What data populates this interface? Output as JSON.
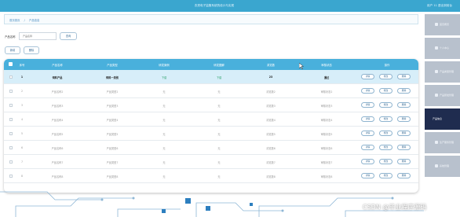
{
  "header": {
    "title": "农资电子监管系统的设计与实现",
    "user_info": "用户 11   退出到前台"
  },
  "breadcrumb": [
    "首页首页",
    "产品信息"
  ],
  "search": {
    "label": "产品名称",
    "placeholder": "产品名称",
    "button": "查询"
  },
  "toolbar": {
    "add": "新增",
    "delete": "删除"
  },
  "table": {
    "headers": [
      "序号",
      "产品名称",
      "产品类型",
      "研发案例",
      "研发图解",
      "浏览数",
      "审核状态",
      "操作"
    ],
    "actions": [
      "详情",
      "修改",
      "删除"
    ],
    "rows": [
      [
        "1",
        "饲料产品",
        "饲料一类别",
        "下载",
        "下载",
        "23",
        "通过"
      ],
      [
        "2",
        "产品名称2",
        "产品类型2",
        "无",
        "无",
        "浏览数2",
        "审核状态2"
      ],
      [
        "3",
        "产品名称3",
        "产品类型3",
        "无",
        "无",
        "浏览数3",
        "审核状态3"
      ],
      [
        "4",
        "产品名称4",
        "产品类型4",
        "无",
        "无",
        "浏览数4",
        "审核状态4"
      ],
      [
        "5",
        "产品名称5",
        "产品类型5",
        "无",
        "无",
        "浏览数5",
        "审核状态5"
      ],
      [
        "6",
        "产品名称6",
        "产品类型6",
        "无",
        "无",
        "浏览数6",
        "审核状态6"
      ],
      [
        "7",
        "产品名称7",
        "产品类型7",
        "无",
        "无",
        "浏览数7",
        "审核状态7"
      ],
      [
        "8",
        "产品名称8",
        "产品类型8",
        "无",
        "无",
        "浏览数8",
        "审核状态8"
      ]
    ]
  },
  "sidebar": {
    "items": [
      "首页概览",
      "个人中心",
      "产品类型管理",
      "产品研发管理",
      "产品信息",
      "生产服务管理",
      "系统管理"
    ],
    "active_index": 4
  },
  "watermark": "CSDN @毕业程序源码",
  "colors": {
    "header": "#3aa6cf",
    "table_header": "#49b0dc",
    "sidebar": "#b8c1cd",
    "sidebar_active": "#1f2c4f",
    "first_row": "#d7eef9"
  }
}
